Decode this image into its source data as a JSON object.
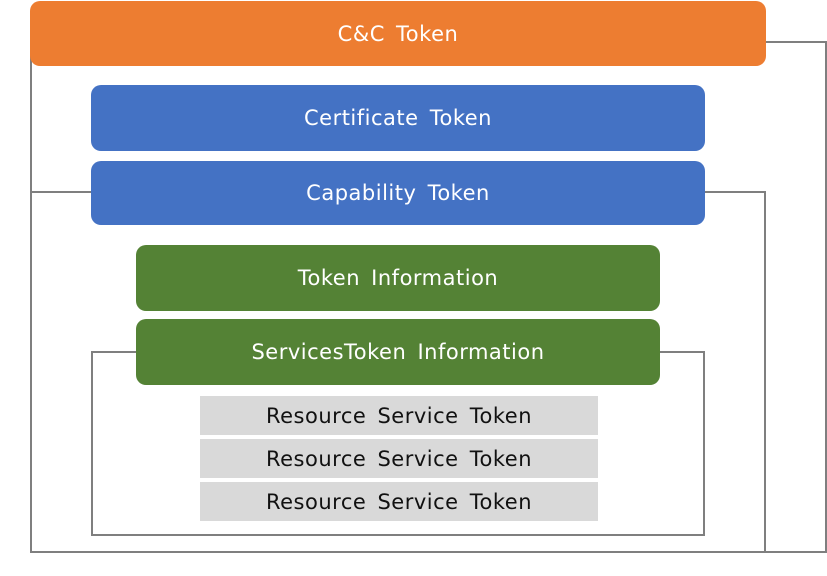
{
  "diagram": {
    "cc_token": "C&C Token",
    "certificate_token": "Certificate Token",
    "capability_token": "Capability Token",
    "token_information": "Token Information",
    "services_token_information": "ServicesToken Information",
    "resource_service_tokens": [
      "Resource Service Token",
      "Resource Service Token",
      "Resource Service Token"
    ]
  },
  "colors": {
    "orange": "#ed7d31",
    "blue": "#4472c4",
    "green": "#548235",
    "grey": "#d9d9d9",
    "frame": "#7f7f7f"
  }
}
